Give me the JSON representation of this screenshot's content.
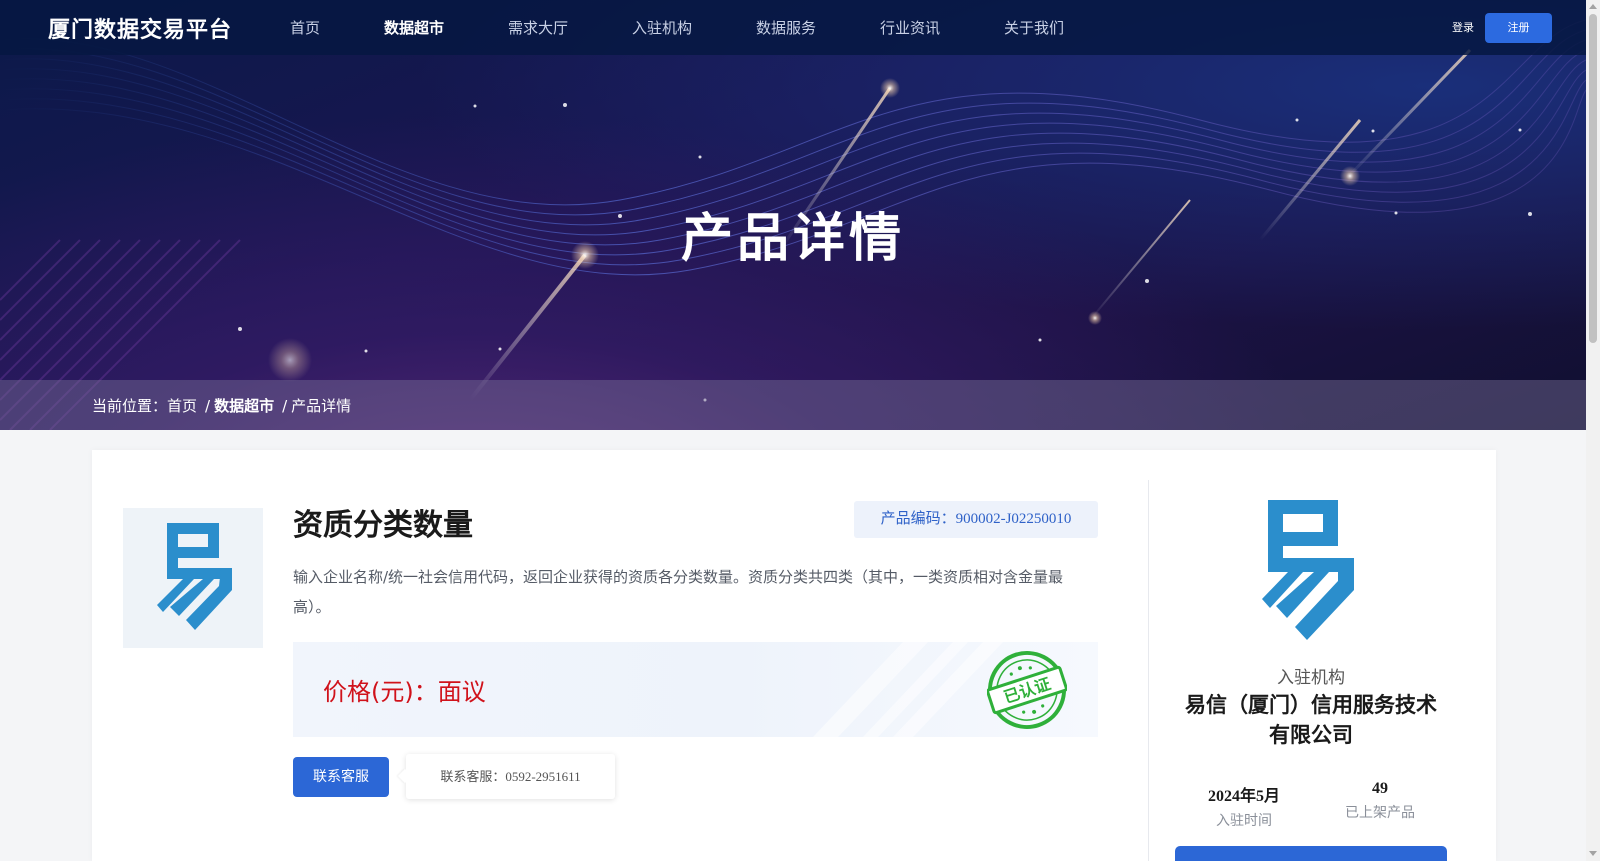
{
  "header": {
    "logo": "厦门数据交易平台",
    "nav": [
      {
        "label": "首页",
        "active": false
      },
      {
        "label": "数据超市",
        "active": true
      },
      {
        "label": "需求大厅",
        "active": false
      },
      {
        "label": "入驻机构",
        "active": false
      },
      {
        "label": "数据服务",
        "active": false
      },
      {
        "label": "行业资讯",
        "active": false
      },
      {
        "label": "关于我们",
        "active": false
      }
    ],
    "login": "登录",
    "register": "注册"
  },
  "banner": {
    "title": "产品详情"
  },
  "breadcrumb": {
    "prefix": "当前位置：",
    "home": "首页",
    "separator": "/",
    "market": "数据超市",
    "current": "产品详情"
  },
  "product": {
    "image_icon": "yi-logo-icon",
    "title": "资质分类数量",
    "code": "产品编码：900002-J02250010",
    "description": "输入企业名称/统一社会信用代码，返回企业获得的资质各分类数量。资质分类共四类（其中，一类资质相对含金量最高）。",
    "price": "价格(元)：面议",
    "stamp_text": "已认证",
    "contact_button": "联系客服",
    "contact_tip": "联系客服：0592-2951611"
  },
  "organization": {
    "logo_icon": "yi-logo-icon",
    "label": "入驻机构",
    "name_line1": "易信（厦门）信用服务技术",
    "name_line2": "有限公司",
    "join_time": "2024年5月",
    "join_time_label": "入驻时间",
    "product_count": "49",
    "product_count_label": "已上架产品"
  },
  "colors": {
    "primary": "#2c67d6",
    "price_red": "#d0121b",
    "stamp_green": "#2fb03a",
    "logo_blue": "#2b8ecc"
  }
}
